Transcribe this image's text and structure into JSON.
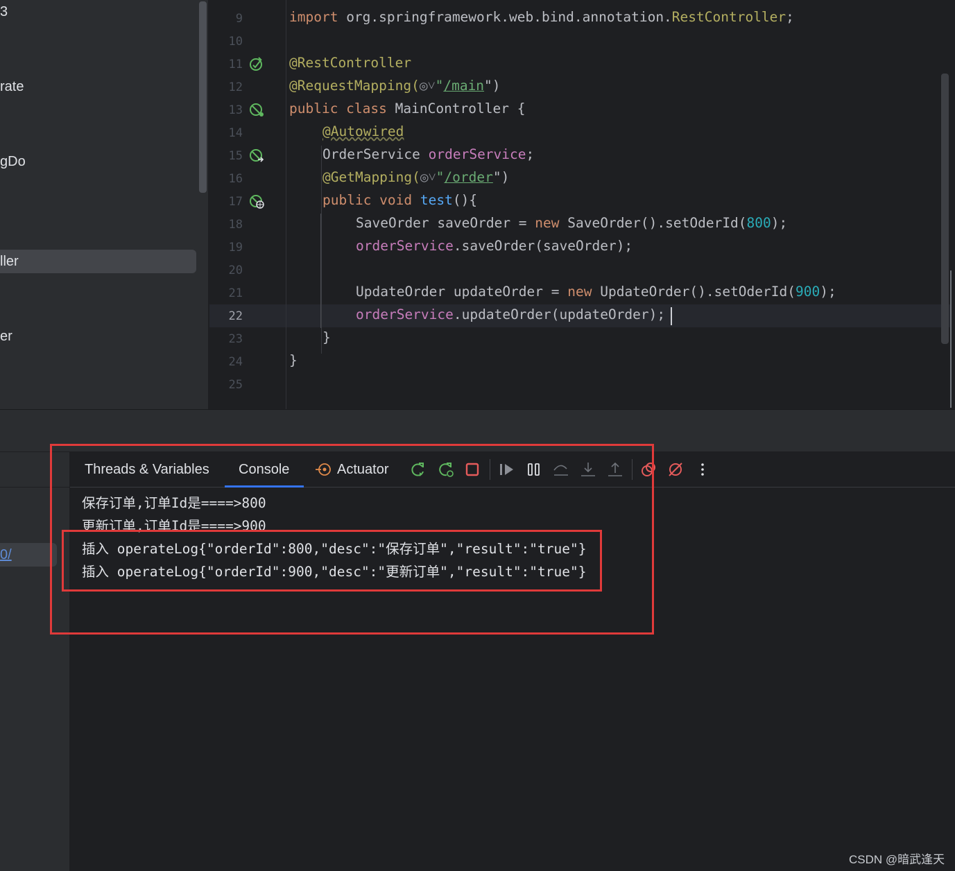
{
  "sidebar": {
    "items": [
      "3",
      "rate",
      "gDo",
      "ller",
      "er"
    ]
  },
  "editor": {
    "line_numbers": [
      "9",
      "10",
      "11",
      "12",
      "13",
      "14",
      "15",
      "16",
      "17",
      "18",
      "19",
      "20",
      "21",
      "22",
      "23",
      "24",
      "25"
    ],
    "current_line": "22",
    "lines": {
      "l9_kw": "import",
      "l9_rest": " org.springframework.web.bind.annotation.",
      "l9_cls": "RestController",
      "l9_end": ";",
      "l11": "@RestController",
      "l12_ann": "@RequestMapping(",
      "l12_hint": "◎˅",
      "l12_q1": "\"",
      "l12_path": "/main",
      "l12_q2": "\")",
      "l13_kw": "public class ",
      "l13_rest": "MainController {",
      "l14": "@Autowired",
      "l15_type": "OrderService ",
      "l15_field": "orderService",
      "l15_end": ";",
      "l16_ann": "@GetMapping(",
      "l16_hint": "◎˅",
      "l16_q1": "\"",
      "l16_path": "/order",
      "l16_q2": "\")",
      "l17_kw": "public void ",
      "l17_method": "test",
      "l17_end": "(){",
      "l18_a": "SaveOrder saveOrder = ",
      "l18_new": "new",
      "l18_b": " SaveOrder().setOderId(",
      "l18_num": "800",
      "l18_c": ");",
      "l19_field": "orderService",
      "l19_rest": ".saveOrder(saveOrder);",
      "l21_a": "UpdateOrder updateOrder = ",
      "l21_new": "new",
      "l21_b": " UpdateOrder().setOderId(",
      "l21_num": "900",
      "l21_c": ");",
      "l22_field": "orderService",
      "l22_rest": ".updateOrder(updateOrder);",
      "l23": "}",
      "l24": "}"
    }
  },
  "debug": {
    "left_link": "0/",
    "tabs": {
      "threads": "Threads & Variables",
      "console": "Console",
      "actuator": "Actuator"
    },
    "toolbar_icons": [
      "rerun-icon",
      "rerun-debug-icon",
      "stop-icon",
      "resume-icon",
      "pause-icon",
      "step-over-icon",
      "step-into-icon",
      "step-out-icon",
      "view-breakpoints-icon",
      "mute-breakpoints-icon",
      "more-icon"
    ],
    "console_lines": [
      "保存订单,订单Id是====>800",
      "更新订单,订单Id是====>900",
      "插入 operateLog{\"orderId\":800,\"desc\":\"保存订单\",\"result\":\"true\"}",
      "插入 operateLog{\"orderId\":900,\"desc\":\"更新订单\",\"result\":\"true\"}"
    ]
  },
  "colors": {
    "highlight_box": "#e03a3a",
    "keyword": "#cf8e6d",
    "annotation": "#b3ae60",
    "field": "#c77dbb",
    "number": "#2aacb8"
  },
  "watermark": "CSDN @暗武逢天"
}
